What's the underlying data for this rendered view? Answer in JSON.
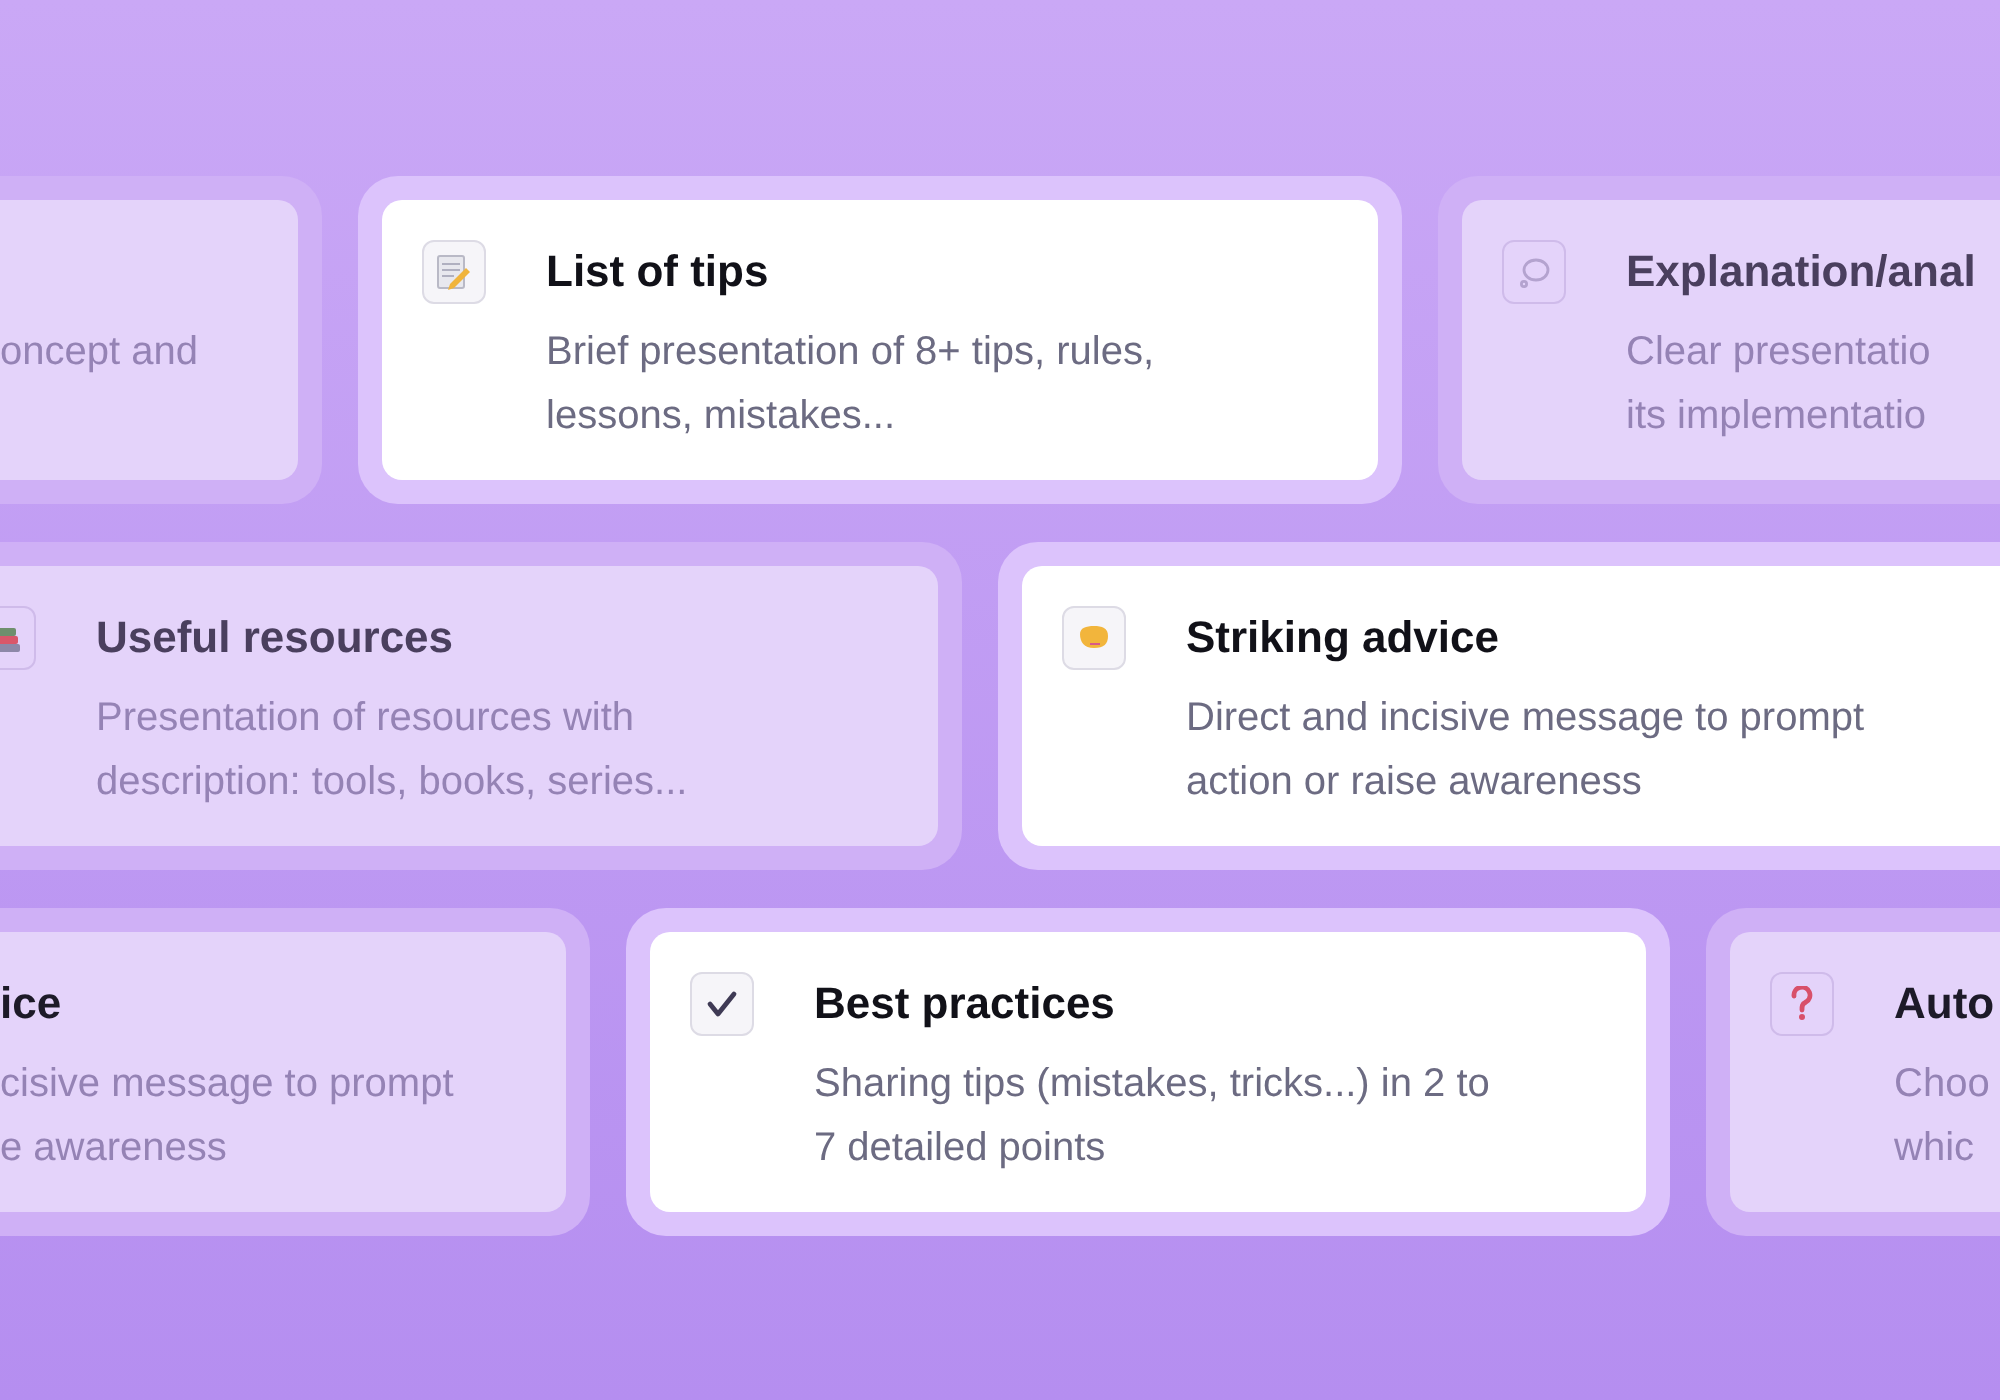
{
  "rows": [
    {
      "cards": [
        {
          "highlighted": false,
          "lines": [
            "oncept and"
          ]
        },
        {
          "highlighted": true,
          "title": "List of tips",
          "lines": [
            "Brief presentation of 8+ tips, rules,",
            "lessons, mistakes..."
          ]
        },
        {
          "highlighted": false,
          "title": "Explanation/anal",
          "lines": [
            "Clear presentatio",
            "its implementatio"
          ]
        }
      ]
    },
    {
      "cards": [
        {
          "highlighted": false,
          "title": "Useful resources",
          "lines": [
            "Presentation of resources with",
            "description: tools, books, series..."
          ]
        },
        {
          "highlighted": true,
          "title": "Striking advice",
          "lines": [
            "Direct and incisive message to prompt",
            "action or raise awareness"
          ]
        }
      ]
    },
    {
      "cards": [
        {
          "highlighted": false,
          "title": "ice",
          "lines": [
            "cisive message to prompt",
            "e awareness"
          ]
        },
        {
          "highlighted": true,
          "title": "Best practices",
          "lines": [
            "Sharing tips (mistakes, tricks...) in 2 to",
            "7 detailed points"
          ]
        },
        {
          "highlighted": false,
          "title": "Auto",
          "lines": [
            "Choo",
            "whic"
          ]
        }
      ]
    }
  ]
}
